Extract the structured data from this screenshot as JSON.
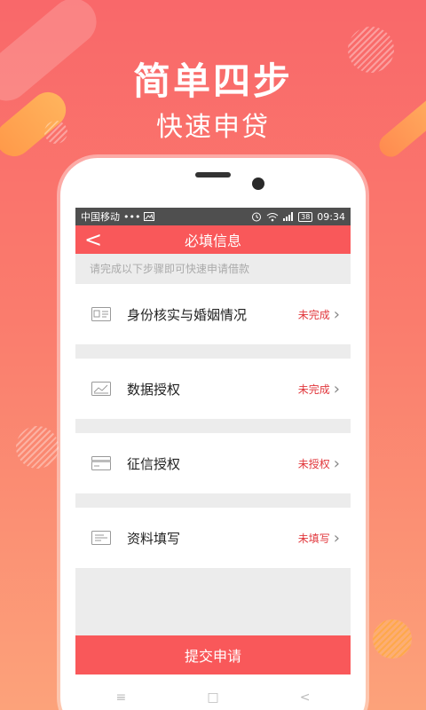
{
  "promo": {
    "headline": "简单四步",
    "subheadline": "快速申贷"
  },
  "statusbar": {
    "carrier": "中国移动",
    "dots": "•••",
    "battery": "38",
    "time": "09:34"
  },
  "navbar": {
    "back": "<",
    "title": "必填信息"
  },
  "hint": "请完成以下步骤即可快速申请借款",
  "steps": [
    {
      "label": "身份核实与婚姻情况",
      "status": "未完成",
      "icon": "id-card-icon"
    },
    {
      "label": "数据授权",
      "status": "未完成",
      "icon": "data-chart-icon"
    },
    {
      "label": "征信授权",
      "status": "未授权",
      "icon": "credit-card-icon"
    },
    {
      "label": "资料填写",
      "status": "未填写",
      "icon": "form-icon"
    }
  ],
  "chevron": "›",
  "submit_label": "提交申请",
  "softkeys": {
    "menu": "≡",
    "home": "□",
    "back": "<"
  },
  "colors": {
    "accent": "#f9585a",
    "status_text": "#e1363b",
    "statusbar": "#4f4f4f"
  }
}
